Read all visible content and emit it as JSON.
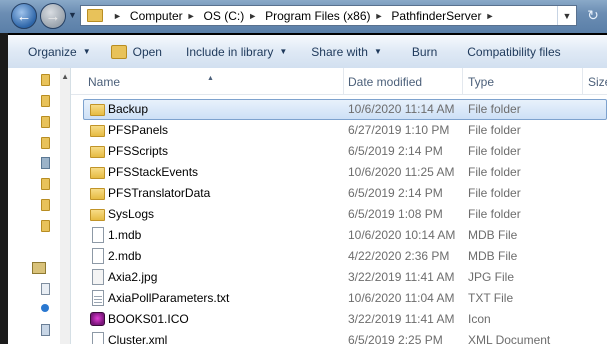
{
  "address": {
    "crumbs": [
      "Computer",
      "OS (C:)",
      "Program Files (x86)",
      "PathfinderServer"
    ]
  },
  "toolbar": {
    "organize": "Organize",
    "open": "Open",
    "include": "Include in library",
    "share": "Share with",
    "burn": "Burn",
    "compat": "Compatibility files"
  },
  "columns": {
    "name": "Name",
    "date": "Date modified",
    "type": "Type",
    "size": "Size"
  },
  "files": [
    {
      "name": "Backup",
      "date": "10/6/2020 11:14 AM",
      "type": "File folder",
      "icon": "folder-icon",
      "selected": true
    },
    {
      "name": "PFSPanels",
      "date": "6/27/2019 1:10 PM",
      "type": "File folder",
      "icon": "folder-icon"
    },
    {
      "name": "PFSScripts",
      "date": "6/5/2019 2:14 PM",
      "type": "File folder",
      "icon": "folder-icon"
    },
    {
      "name": "PFSStackEvents",
      "date": "10/6/2020 11:25 AM",
      "type": "File folder",
      "icon": "folder-icon"
    },
    {
      "name": "PFSTranslatorData",
      "date": "6/5/2019 2:14 PM",
      "type": "File folder",
      "icon": "folder-icon"
    },
    {
      "name": "SysLogs",
      "date": "6/5/2019 1:08 PM",
      "type": "File folder",
      "icon": "folder-icon"
    },
    {
      "name": "1.mdb",
      "date": "10/6/2020 10:14 AM",
      "type": "MDB File",
      "icon": "file-icon"
    },
    {
      "name": "2.mdb",
      "date": "4/22/2020 2:36 PM",
      "type": "MDB File",
      "icon": "file-icon"
    },
    {
      "name": "Axia2.jpg",
      "date": "3/22/2019 11:41 AM",
      "type": "JPG File",
      "icon": "image-file-icon"
    },
    {
      "name": "AxiaPollParameters.txt",
      "date": "10/6/2020 11:04 AM",
      "type": "TXT File",
      "icon": "text-file-icon"
    },
    {
      "name": "BOOKS01.ICO",
      "date": "3/22/2019 11:41 AM",
      "type": "Icon",
      "icon": "books-icon"
    },
    {
      "name": "Cluster.xml",
      "date": "6/5/2019 2:25 PM",
      "type": "XML Document",
      "icon": "xml-file-icon"
    }
  ]
}
